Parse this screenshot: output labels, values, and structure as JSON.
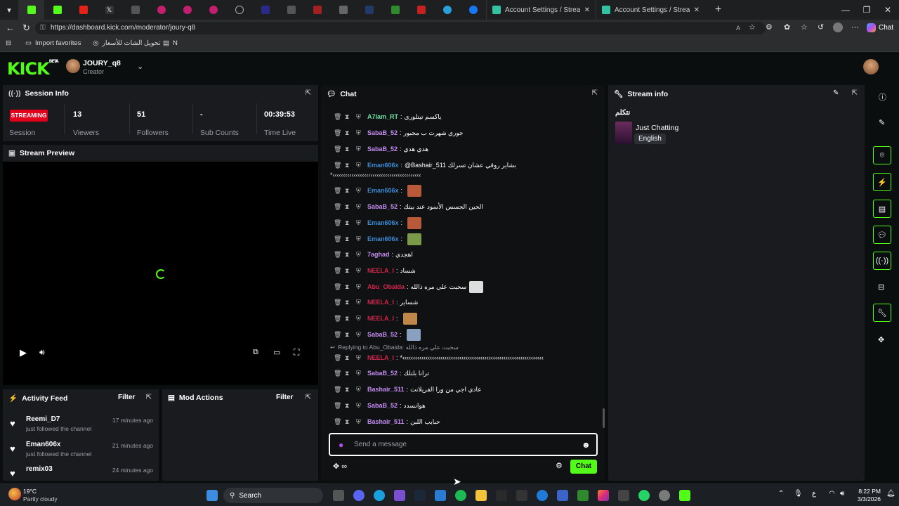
{
  "browser": {
    "tabs": [
      {
        "title": "Account Settings / Streamlabs"
      },
      {
        "title": "Account Settings / Streamlabs"
      }
    ],
    "url": "https://dashboard.kick.com/moderator/joury-q8",
    "chat_label": "Chat",
    "favorites": [
      {
        "label": "Import favorites"
      },
      {
        "label": "تحويل الشات للأسعار"
      },
      {
        "label": "N"
      }
    ]
  },
  "header": {
    "logo": "KICK",
    "logo_beta": "BETA",
    "channel_name": "JOURY_q8",
    "channel_role": "Creator"
  },
  "session": {
    "title": "Session Info",
    "status_badge": "STREAMING",
    "status_label": "Session",
    "stats": [
      {
        "value": "13",
        "label": "Viewers"
      },
      {
        "value": "51",
        "label": "Followers"
      },
      {
        "value": "-",
        "label": "Sub Counts"
      },
      {
        "value": "00:39:53",
        "label": "Time Live"
      }
    ]
  },
  "preview": {
    "title": "Stream Preview"
  },
  "activity": {
    "title": "Activity Feed",
    "filter": "Filter",
    "items": [
      {
        "name": "Reemi_D7",
        "action": "just followed the channel",
        "time": "17 minutes ago"
      },
      {
        "name": "Eman606x",
        "action": "just followed the channel",
        "time": "21 minutes ago"
      },
      {
        "name": "remix03",
        "action": "",
        "time": "24 minutes ago"
      }
    ]
  },
  "mod_actions": {
    "title": "Mod Actions",
    "filter": "Filter"
  },
  "chat": {
    "title": "Chat",
    "messages": [
      {
        "user": "A7lam_RT",
        "color": "#6ee2a5",
        "text": "ياكسم تيتلوري"
      },
      {
        "user": "SabaB_52",
        "color": "#c58cf2",
        "text": "جوري شهرت ب مجبور"
      },
      {
        "user": "SabaB_52",
        "color": "#c58cf2",
        "text": "هدي هدي"
      },
      {
        "user": "Eman606x",
        "color": "#3c8bd6",
        "text": "@Bashair_511 بشاير روقي عشان تسرلك"
      },
      {
        "user": "Eman606x",
        "color": "#3c8bd6",
        "text": ""
      },
      {
        "user": "SabaB_52",
        "color": "#c58cf2",
        "text": "الحين الجسس الأسود عند بيتك"
      },
      {
        "user": "Eman606x",
        "color": "#3c8bd6",
        "text": ""
      },
      {
        "user": "Eman606x",
        "color": "#3c8bd6",
        "text": ""
      },
      {
        "user": "7aghad",
        "color": "#c58cf2",
        "text": "اهجدي"
      },
      {
        "user": "NEELA_I",
        "color": "#d4254b",
        "text": "شساد"
      },
      {
        "user": "Abu_Obaida",
        "color": "#d4254b",
        "text": "سحبت علي مره ذالله"
      },
      {
        "user": "NEELA_I",
        "color": "#d4254b",
        "text": "شساير"
      },
      {
        "user": "NEELA_I",
        "color": "#d4254b",
        "text": ""
      },
      {
        "user": "SabaB_52",
        "color": "#c58cf2",
        "text": ""
      },
      {
        "user": "NEELA_I",
        "color": "#d4254b",
        "text": "*‹‹‹‹‹‹‹‹‹‹‹‹‹‹‹‹‹‹‹‹‹‹‹‹‹‹‹‹‹‹‹‹‹‹‹‹‹‹‹‹‹‹‹‹‹‹‹‹‹‹‹‹‹‹‹‹‹‹‹‹‹‹‹‹‹‹‹"
      },
      {
        "user": "SabaB_52",
        "color": "#c58cf2",
        "text": "ترانا بلتلك"
      },
      {
        "user": "Bashair_511",
        "color": "#c58cf2",
        "text": "عادي اجي من ورا الفريلانت"
      },
      {
        "user": "SabaB_52",
        "color": "#c58cf2",
        "text": "هوانسدد"
      },
      {
        "user": "Bashair_511",
        "color": "#c58cf2",
        "text": "حبايب اللبن"
      }
    ],
    "wrap_line": "*‹‹‹‹‹‹‹‹‹‹‹‹‹‹‹‹‹‹‹‹‹‹‹‹‹‹‹‹‹‹‹‹‹‹‹‹‹‹‹‹‹‹",
    "reply": "Replying to Abu_Obaida: سحبت علي مره ذالله",
    "input_placeholder": "Send a message",
    "send_label": "Chat"
  },
  "stream_info": {
    "title": "Stream info",
    "stream_title": "نتكلم",
    "category": "Just Chatting",
    "language": "English"
  },
  "taskbar": {
    "weather_temp": "19°C",
    "weather_desc": "Partly cloudy",
    "search": "Search",
    "time": "8:22 PM",
    "date": "3/3/2026",
    "lang": "ع"
  }
}
